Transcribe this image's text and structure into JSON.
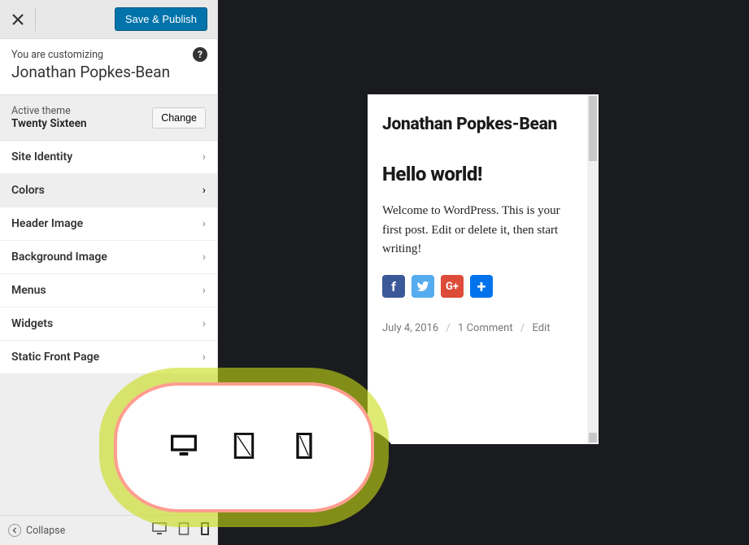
{
  "header": {
    "save_label": "Save & Publish"
  },
  "customizing": {
    "label": "You are customizing",
    "site_title": "Jonathan Popkes-Bean"
  },
  "theme": {
    "label": "Active theme",
    "name": "Twenty Sixteen",
    "change_label": "Change"
  },
  "panels": [
    {
      "label": "Site Identity",
      "active": false
    },
    {
      "label": "Colors",
      "active": true
    },
    {
      "label": "Header Image",
      "active": false
    },
    {
      "label": "Background Image",
      "active": false
    },
    {
      "label": "Menus",
      "active": false
    },
    {
      "label": "Widgets",
      "active": false
    },
    {
      "label": "Static Front Page",
      "active": false
    }
  ],
  "footer": {
    "collapse_label": "Collapse"
  },
  "preview": {
    "site_title": "Jonathan Popkes-Bean",
    "post_title": "Hello world!",
    "post_body": "Welcome to WordPress. This is your first post. Edit or delete it, then start writing!",
    "meta_date": "July 4, 2016",
    "meta_comments": "1 Comment",
    "meta_edit": "Edit"
  }
}
